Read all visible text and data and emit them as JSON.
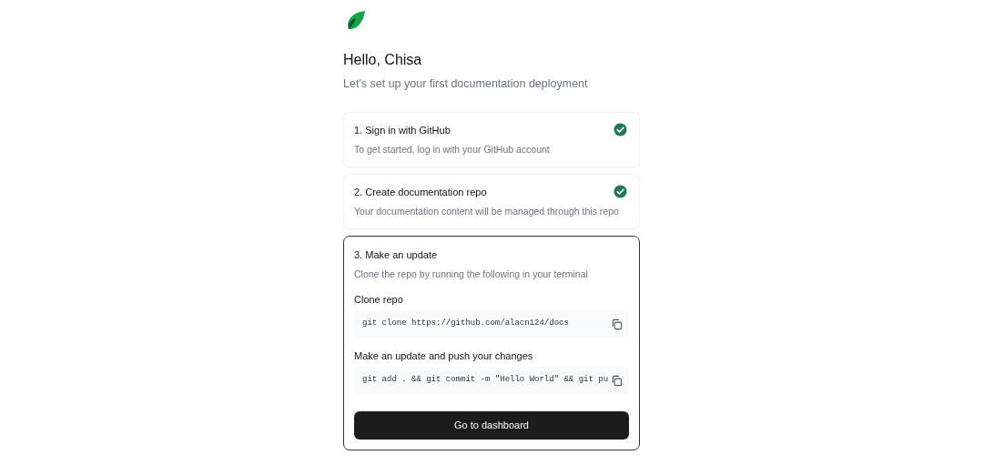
{
  "greeting": "Hello, Chisa",
  "subtitle": "Let's set up your first documentation deployment",
  "steps": [
    {
      "title": "1. Sign in with GitHub",
      "description": "To get started, log in with your GitHub account",
      "completed": true,
      "active": false
    },
    {
      "title": "2. Create documentation repo",
      "description": "Your documentation content will be managed through this repo",
      "completed": true,
      "active": false
    },
    {
      "title": "3. Make an update",
      "description": "Clone the repo by running the following in your terminal",
      "completed": false,
      "active": true,
      "commands": [
        {
          "label": "Clone repo",
          "code": "git clone https://github.com/alacn124/docs"
        },
        {
          "label": "Make an update and push your changes",
          "code": "git add . && git commit -m \"Hello World\" && git pu"
        }
      ],
      "button": "Go to dashboard"
    }
  ]
}
